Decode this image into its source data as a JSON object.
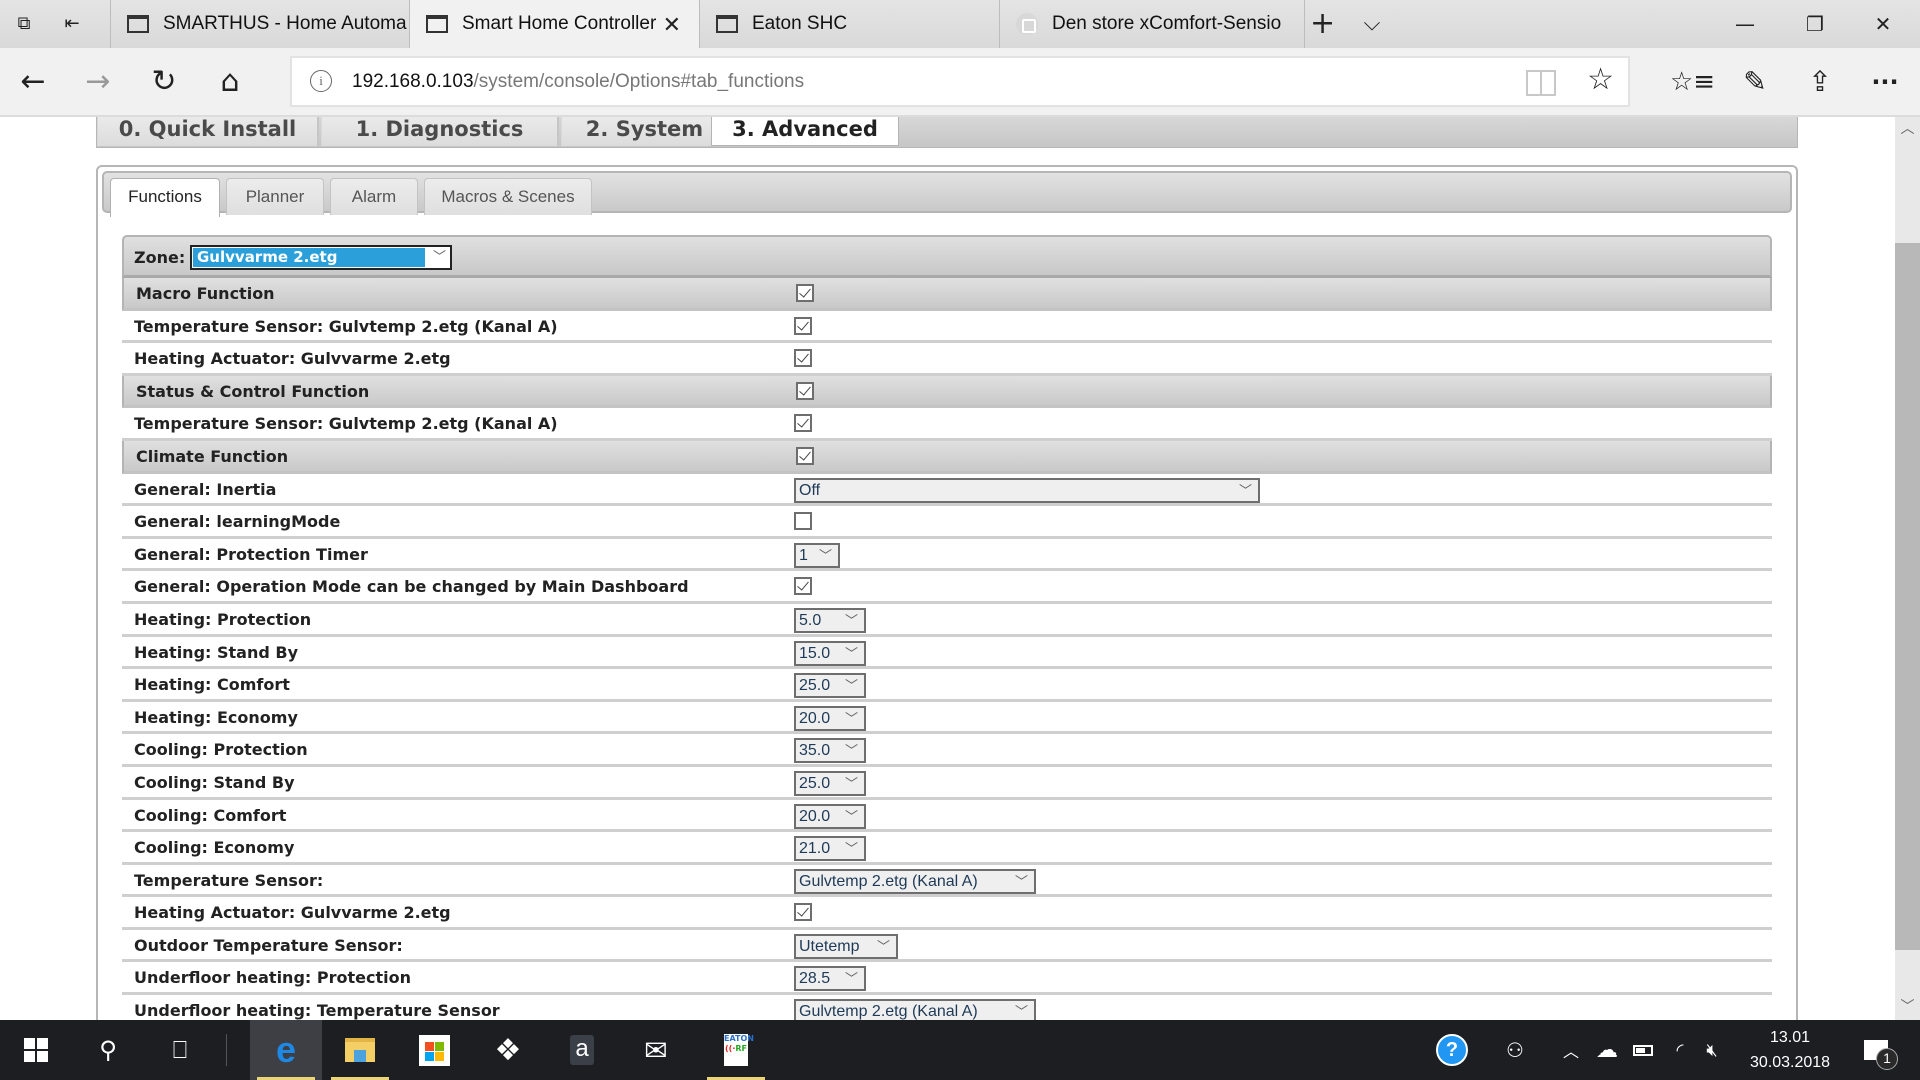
{
  "browser": {
    "tabs": [
      {
        "title": "SMARTHUS - Home Automa",
        "active": false
      },
      {
        "title": "Smart Home Controller",
        "active": true
      },
      {
        "title": "Eaton SHC",
        "active": false
      },
      {
        "title": "Den store xComfort-Sensio",
        "active": false
      }
    ],
    "new_tab": "+",
    "tab_list": "⌄",
    "address": {
      "host": "192.168.0.103",
      "path": "/system/console/Options#tab_functions"
    },
    "window_buttons": {
      "minimize": "—",
      "restore": "❐",
      "close": "✕"
    },
    "nav_icons": {
      "back": "←",
      "forward": "→",
      "refresh": "↻",
      "home": "⌂",
      "favorites": "☆≡",
      "notes": "✎",
      "share": "⇪",
      "more": "···",
      "star": "☆"
    }
  },
  "main_tabs": [
    "0. Quick Install",
    "1. Diagnostics",
    "2. System",
    "3. Advanced"
  ],
  "main_tabs_active": "3. Advanced",
  "sub_tabs": [
    "Functions",
    "Planner",
    "Alarm",
    "Macros & Scenes"
  ],
  "sub_tabs_active": "Functions",
  "zone": {
    "label": "Zone:",
    "value": "Gulvvarme 2.etg"
  },
  "rows": [
    {
      "label": "Macro Function",
      "section": true,
      "type": "checkbox",
      "checked": true
    },
    {
      "label": "Temperature Sensor: Gulvtemp 2.etg (Kanal A)",
      "type": "checkbox",
      "checked": true
    },
    {
      "label": "Heating Actuator: Gulvvarme 2.etg",
      "type": "checkbox",
      "checked": true
    },
    {
      "label": "Status & Control Function",
      "section": true,
      "type": "checkbox",
      "checked": true
    },
    {
      "label": "Temperature Sensor: Gulvtemp 2.etg (Kanal A)",
      "type": "checkbox",
      "checked": true
    },
    {
      "label": "Climate Function",
      "section": true,
      "type": "checkbox",
      "checked": true
    },
    {
      "label": "General: Inertia",
      "type": "select",
      "value": "Off",
      "size": "wide"
    },
    {
      "label": "General: learningMode",
      "type": "checkbox",
      "checked": false
    },
    {
      "label": "General: Protection Timer",
      "type": "select",
      "value": "1",
      "size": "xs"
    },
    {
      "label": "General: Operation Mode can be changed by Main Dashboard",
      "type": "checkbox",
      "checked": true
    },
    {
      "label": "Heating: Protection",
      "type": "select",
      "value": "5.0",
      "size": "sm"
    },
    {
      "label": "Heating: Stand By",
      "type": "select",
      "value": "15.0",
      "size": "sm"
    },
    {
      "label": "Heating: Comfort",
      "type": "select",
      "value": "25.0",
      "size": "sm"
    },
    {
      "label": "Heating: Economy",
      "type": "select",
      "value": "20.0",
      "size": "sm"
    },
    {
      "label": "Cooling: Protection",
      "type": "select",
      "value": "35.0",
      "size": "sm"
    },
    {
      "label": "Cooling: Stand By",
      "type": "select",
      "value": "25.0",
      "size": "sm"
    },
    {
      "label": "Cooling: Comfort",
      "type": "select",
      "value": "20.0",
      "size": "sm"
    },
    {
      "label": "Cooling: Economy",
      "type": "select",
      "value": "21.0",
      "size": "sm"
    },
    {
      "label": "Temperature Sensor:",
      "type": "select",
      "value": "Gulvtemp 2.etg (Kanal A)",
      "size": "lg"
    },
    {
      "label": "Heating Actuator: Gulvvarme 2.etg",
      "type": "checkbox",
      "checked": true
    },
    {
      "label": "Outdoor Temperature Sensor:",
      "type": "select",
      "value": "Utetemp",
      "size": "md"
    },
    {
      "label": "Underfloor heating: Protection",
      "type": "select",
      "value": "28.5",
      "size": "sm"
    },
    {
      "label": "Underfloor heating: Temperature Sensor",
      "type": "select",
      "value": "Gulvtemp 2.etg (Kanal A)",
      "size": "lg"
    }
  ],
  "taskbar": {
    "apps": [
      "start",
      "search",
      "task-view",
      "edge",
      "file-explorer",
      "store",
      "dropbox",
      "amazon",
      "mail",
      "eaton-rf"
    ],
    "tray": {
      "help": "?",
      "people": "people",
      "chevron": "^",
      "notifications_count": "1"
    },
    "time": "13.01",
    "date": "30.03.2018"
  },
  "colors": {
    "zone_highlight": "#2a9fd9",
    "taskbar": "#1c1e22",
    "running_indicator": "#e9d577"
  }
}
